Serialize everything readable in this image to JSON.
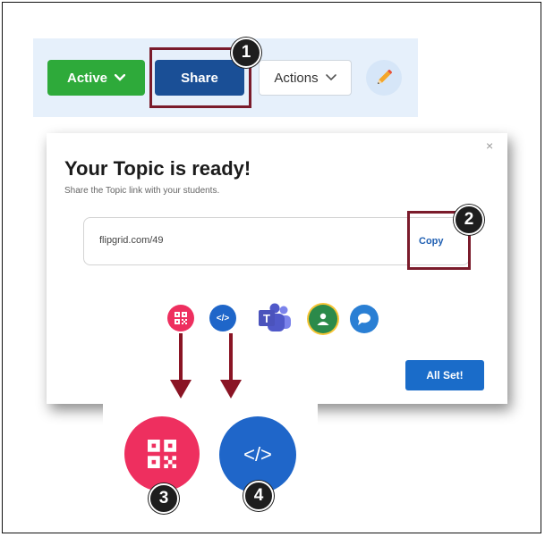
{
  "toolbar": {
    "active_label": "Active",
    "share_label": "Share",
    "actions_label": "Actions"
  },
  "dialog": {
    "title": "Your Topic is ready!",
    "subtitle": "Share the Topic link with your students.",
    "link": "flipgrid.com/49",
    "copy_label": "Copy",
    "close_symbol": "×",
    "all_set_label": "All Set!",
    "share_icons": [
      "qr-code-icon",
      "embed-code-icon",
      "microsoft-teams-icon",
      "google-classroom-icon",
      "remind-icon"
    ]
  },
  "zoom": {
    "embed_symbol": "</>"
  },
  "steps": [
    "1",
    "2",
    "3",
    "4"
  ],
  "colors": {
    "active_green": "#2eaa3a",
    "share_blue": "#1a4f96",
    "highlight_maroon": "#7a1b2b",
    "arrow_maroon": "#8a1424",
    "qr_pink": "#ee2f5f",
    "embed_blue": "#1f66c9",
    "teams_purple": "#5059c9",
    "classroom_green": "#2b8a4a",
    "remind_blue": "#2a7fd4"
  }
}
